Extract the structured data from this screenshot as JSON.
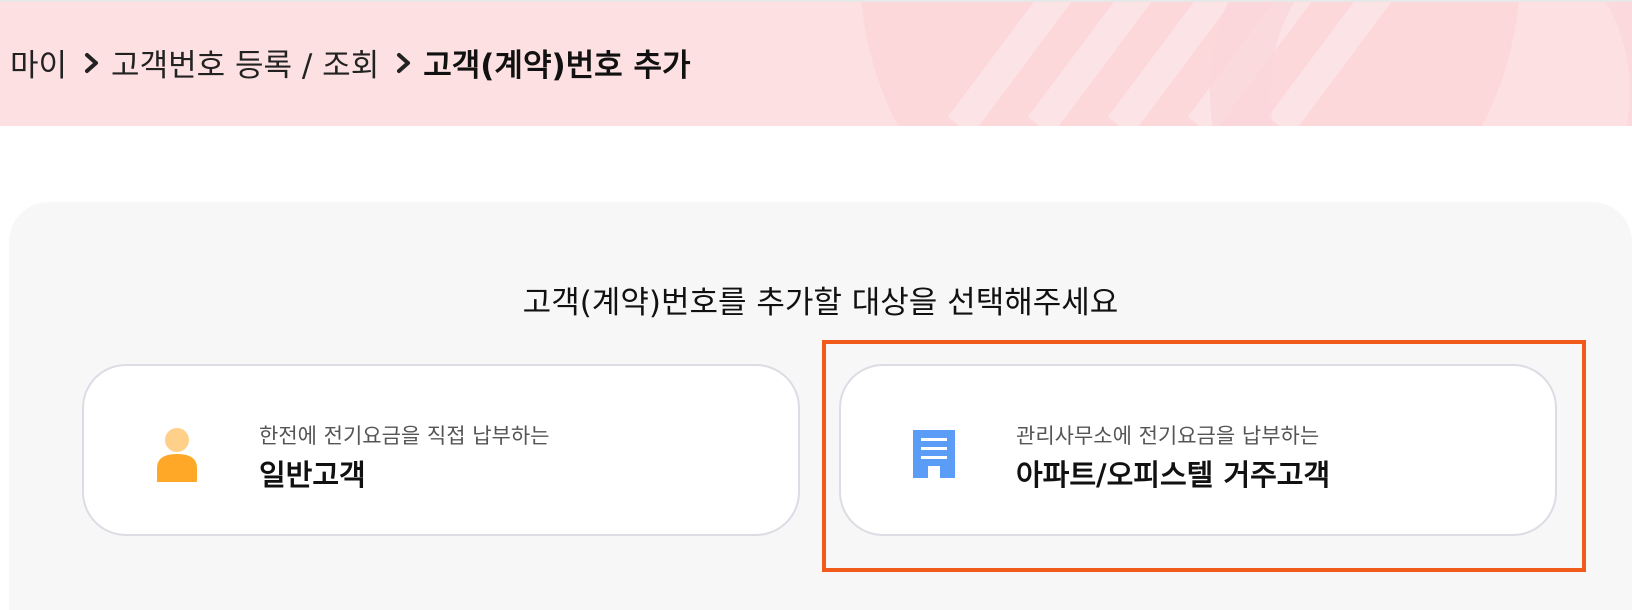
{
  "breadcrumb": {
    "items": [
      "마이",
      "고객번호 등록 / 조회",
      "고객(계약)번호 추가"
    ]
  },
  "prompt": {
    "text": "고객(계약)번호를 추가할 대상을 선택해주세요"
  },
  "options": [
    {
      "subtitle": "한전에 전기요금을 직접 납부하는",
      "title": "일반고객",
      "icon": "person-icon",
      "icon_color": "#ffa726"
    },
    {
      "subtitle": "관리사무소에 전기요금을 납부하는",
      "title": "아파트/오피스텔 거주고객",
      "icon": "apartment-building-icon",
      "icon_color": "#5b9cf6"
    }
  ],
  "colors": {
    "header_band": "#fde0e2",
    "panel": "#f7f7f7",
    "highlight_border": "#f05a1a"
  }
}
